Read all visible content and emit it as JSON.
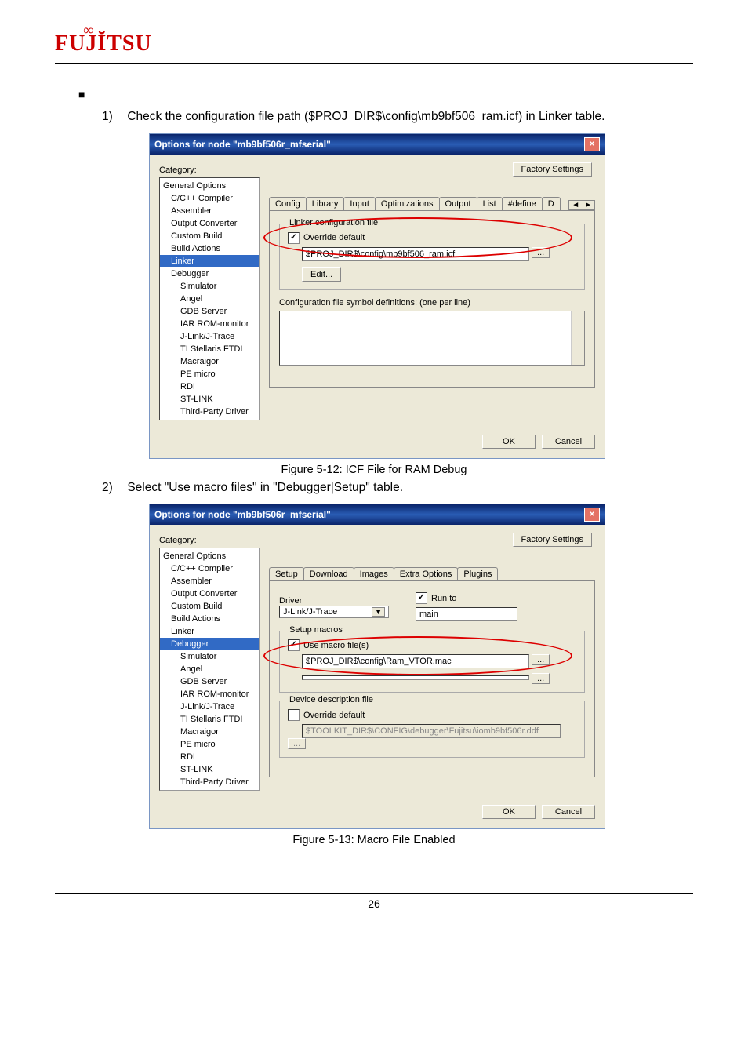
{
  "logo": "FUJITSU",
  "step1_num": "1)",
  "step1_text": "Check the configuration file path ($PROJ_DIR$\\config\\mb9bf506_ram.icf) in Linker table.",
  "step2_num": "2)",
  "step2_text": "Select \"Use macro files\" in \"Debugger|Setup\" table.",
  "dialog1": {
    "title": "Options for node \"mb9bf506r_mfserial\"",
    "category_label": "Category:",
    "factory_btn": "Factory Settings",
    "tree": [
      "General Options",
      "C/C++ Compiler",
      "Assembler",
      "Output Converter",
      "Custom Build",
      "Build Actions",
      "Linker",
      "Debugger",
      "Simulator",
      "Angel",
      "GDB Server",
      "IAR ROM-monitor",
      "J-Link/J-Trace",
      "TI Stellaris FTDI",
      "Macraigor",
      "PE micro",
      "RDI",
      "ST-LINK",
      "Third-Party Driver"
    ],
    "selected": "Linker",
    "tabs": [
      "Config",
      "Library",
      "Input",
      "Optimizations",
      "Output",
      "List",
      "#define",
      "D"
    ],
    "group1_title": "Linker configuration file",
    "override_label": "Override default",
    "config_path": "$PROJ_DIR$\\config\\mb9bf506_ram.icf",
    "edit_btn": "Edit...",
    "symbols_label": "Configuration file symbol definitions: (one per line)",
    "ok": "OK",
    "cancel": "Cancel"
  },
  "caption1": "Figure 5-12:  ICF File for RAM Debug",
  "dialog2": {
    "title": "Options for node \"mb9bf506r_mfserial\"",
    "category_label": "Category:",
    "factory_btn": "Factory Settings",
    "tree": [
      "General Options",
      "C/C++ Compiler",
      "Assembler",
      "Output Converter",
      "Custom Build",
      "Build Actions",
      "Linker",
      "Debugger",
      "Simulator",
      "Angel",
      "GDB Server",
      "IAR ROM-monitor",
      "J-Link/J-Trace",
      "TI Stellaris FTDI",
      "Macraigor",
      "PE micro",
      "RDI",
      "ST-LINK",
      "Third-Party Driver"
    ],
    "selected": "Debugger",
    "tabs": [
      "Setup",
      "Download",
      "Images",
      "Extra Options",
      "Plugins"
    ],
    "driver_label": "Driver",
    "driver_value": "J-Link/J-Trace",
    "runto_label": "Run to",
    "runto_value": "main",
    "setup_macros_title": "Setup macros",
    "use_macro_label": "Use macro file(s)",
    "macro_path": "$PROJ_DIR$\\config\\Ram_VTOR.mac",
    "dev_desc_title": "Device description file",
    "override_label": "Override default",
    "ddf_path": "$TOOLKIT_DIR$\\CONFIG\\debugger\\Fujitsu\\iomb9bf506r.ddf",
    "ok": "OK",
    "cancel": "Cancel"
  },
  "caption2": "Figure 5-13:  Macro File Enabled",
  "page_number": "26"
}
